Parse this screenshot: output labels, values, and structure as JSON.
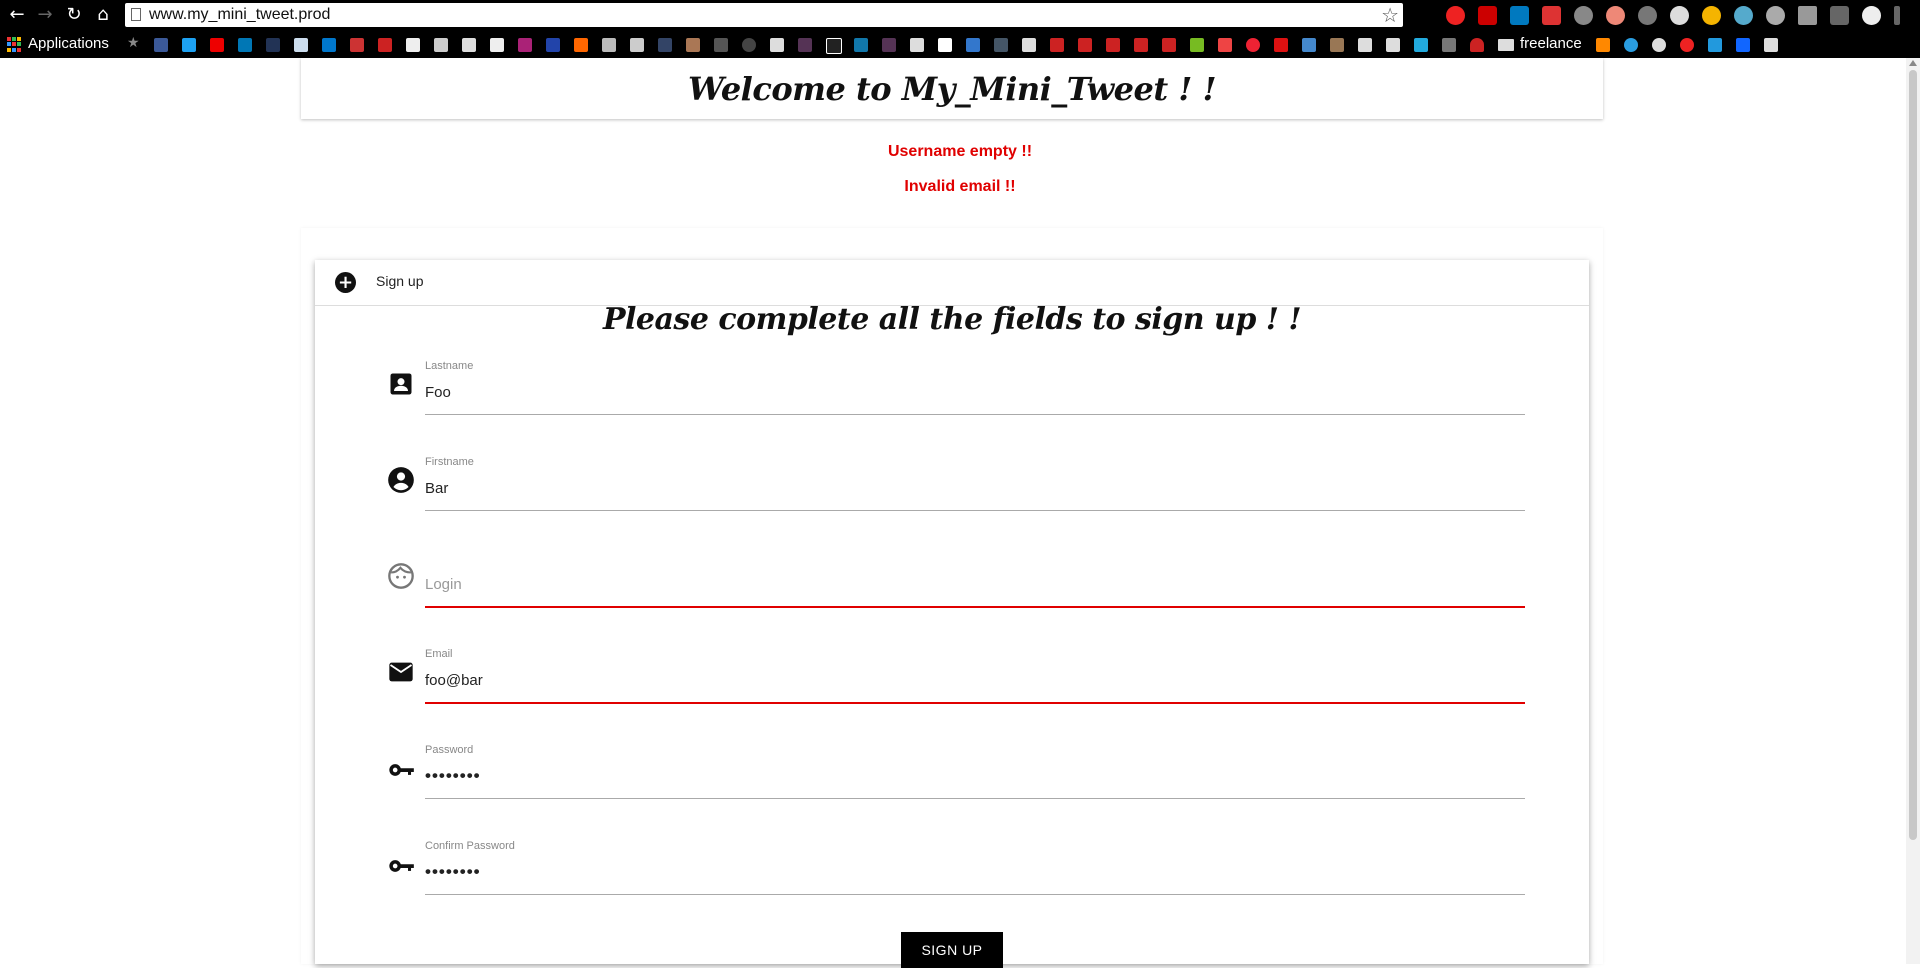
{
  "browser": {
    "url": "www.my_mini_tweet.prod",
    "bookmarks_apps_label": "Applications",
    "bookmark_folder_label": "freelance"
  },
  "header": {
    "title": "Welcome to My_Mini_Tweet ! !"
  },
  "errors": [
    "Username empty !!",
    "Invalid email !!"
  ],
  "panel": {
    "title": "Sign up",
    "form_title": "Please complete all the fields to sign up ! !"
  },
  "fields": [
    {
      "icon": "contact-card-icon",
      "label": "Lastname",
      "value": "Foo",
      "placeholder": "",
      "error": false
    },
    {
      "icon": "account-circle-icon",
      "label": "Firstname",
      "value": "Bar",
      "placeholder": "",
      "error": false
    },
    {
      "icon": "face-icon",
      "label": "",
      "value": "",
      "placeholder": "Login",
      "error": true
    },
    {
      "icon": "email-icon",
      "label": "Email",
      "value": "foo@bar",
      "placeholder": "",
      "error": true
    },
    {
      "icon": "key-icon",
      "label": "Password",
      "value": "••••••••",
      "placeholder": "",
      "error": false
    },
    {
      "icon": "key-icon",
      "label": "Confirm Password",
      "value": "••••••••",
      "placeholder": "",
      "error": false
    }
  ],
  "submit_label": "Sign up",
  "colors": {
    "error": "#e00000",
    "button": "#000000"
  }
}
